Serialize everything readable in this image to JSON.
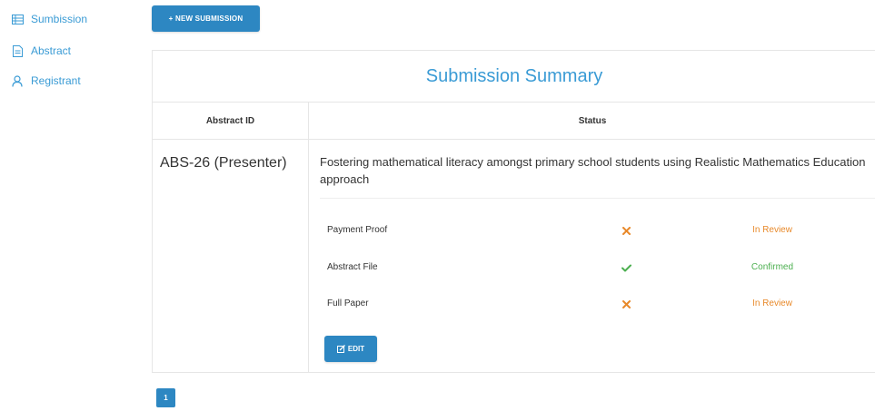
{
  "sidebar": {
    "items": [
      {
        "label": "Sumbission",
        "icon": "list-icon"
      },
      {
        "label": "Abstract",
        "icon": "document-icon"
      },
      {
        "label": "Registrant",
        "icon": "user-icon"
      }
    ]
  },
  "toolbar": {
    "new_submission_label": "+ NEW SUBMISSION"
  },
  "summary": {
    "title": "Submission Summary",
    "columns": {
      "abstract_id": "Abstract ID",
      "status": "Status"
    },
    "row": {
      "abstract_id": "ABS-26 (Presenter)",
      "title": "Fostering mathematical literacy amongst primary school students using Realistic Mathematics Education approach",
      "documents": [
        {
          "label": "Payment Proof",
          "mark": "cross-icon",
          "status": "In Review"
        },
        {
          "label": "Abstract File",
          "mark": "check-icon",
          "status": "Confirmed"
        },
        {
          "label": "Full Paper",
          "mark": "cross-icon",
          "status": "In Review"
        }
      ],
      "edit_label": "EDIT"
    }
  },
  "pagination": {
    "current_page": "1"
  },
  "colors": {
    "accent": "#3a9bd5",
    "button": "#2d87c2",
    "in_review": "#e8892a",
    "confirmed": "#4caf50"
  }
}
